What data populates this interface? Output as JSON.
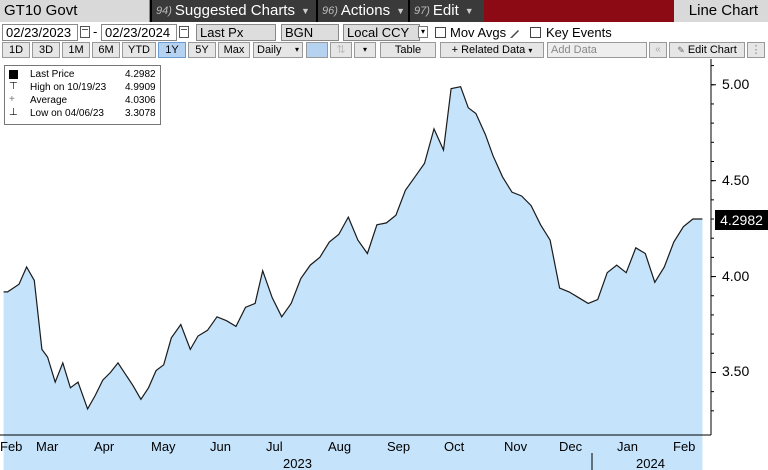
{
  "titlebar": {
    "security": "GT10 Govt",
    "menus": [
      {
        "num": "94)",
        "label": "Suggested Charts"
      },
      {
        "num": "96)",
        "label": "Actions"
      },
      {
        "num": "97)",
        "label": "Edit"
      }
    ],
    "window_title": "Line Chart"
  },
  "controls": {
    "start_date": "02/23/2023",
    "end_date": "02/23/2024",
    "field": "Last Px",
    "source": "BGN",
    "currency": "Local CCY",
    "mov_avgs_label": "Mov Avgs",
    "key_events_label": "Key Events"
  },
  "toolbar": {
    "periods": [
      "1D",
      "3D",
      "1M",
      "6M",
      "YTD",
      "1Y",
      "5Y",
      "Max"
    ],
    "selected_period": "1Y",
    "frequency": "Daily",
    "table_label": "Table",
    "related_data_label": "+ Related Data",
    "add_data_placeholder": "Add Data",
    "edit_chart_label": "Edit Chart"
  },
  "legend": {
    "items": [
      {
        "label": "Last Price",
        "value": "4.2982"
      },
      {
        "label": "High on 10/19/23",
        "value": "4.9909"
      },
      {
        "label": "Average",
        "value": "4.0306"
      },
      {
        "label": "Low on 04/06/23",
        "value": "3.3078"
      }
    ]
  },
  "last_value_badge": "4.2982",
  "colors": {
    "line": "#1a1a1a",
    "fill": "#c5e3fa",
    "titlebar_red": "#8b0a14",
    "selected_button": "#b5d3f1"
  },
  "chart_data": {
    "type": "area",
    "title": "",
    "xlabel": "",
    "ylabel": "",
    "ylim": [
      3.2,
      5.15
    ],
    "yticks": [
      3.5,
      4.0,
      4.5,
      5.0
    ],
    "ytick_labels": [
      "3.50",
      "4.00",
      "4.50",
      "5.00"
    ],
    "x_month_labels": [
      "Feb",
      "Mar",
      "Apr",
      "May",
      "Jun",
      "Jul",
      "Aug",
      "Sep",
      "Oct",
      "Nov",
      "Dec",
      "Jan",
      "Feb"
    ],
    "x_year_labels": [
      "2023",
      "2024"
    ],
    "grid": false,
    "legend_position": "top-left",
    "series": [
      {
        "name": "Last Price",
        "x": [
          "2023-02-23",
          "2023-03-01",
          "2023-03-05",
          "2023-03-09",
          "2023-03-13",
          "2023-03-16",
          "2023-03-20",
          "2023-03-24",
          "2023-03-28",
          "2023-04-01",
          "2023-04-06",
          "2023-04-10",
          "2023-04-14",
          "2023-04-18",
          "2023-04-22",
          "2023-04-26",
          "2023-04-30",
          "2023-05-04",
          "2023-05-08",
          "2023-05-12",
          "2023-05-16",
          "2023-05-20",
          "2023-05-25",
          "2023-05-30",
          "2023-06-03",
          "2023-06-08",
          "2023-06-13",
          "2023-06-18",
          "2023-06-23",
          "2023-06-28",
          "2023-07-03",
          "2023-07-07",
          "2023-07-12",
          "2023-07-17",
          "2023-07-22",
          "2023-07-27",
          "2023-08-01",
          "2023-08-06",
          "2023-08-11",
          "2023-08-16",
          "2023-08-21",
          "2023-08-26",
          "2023-08-31",
          "2023-09-05",
          "2023-09-10",
          "2023-09-15",
          "2023-09-20",
          "2023-09-25",
          "2023-09-30",
          "2023-10-05",
          "2023-10-10",
          "2023-10-14",
          "2023-10-19",
          "2023-10-23",
          "2023-10-27",
          "2023-11-01",
          "2023-11-05",
          "2023-11-10",
          "2023-11-15",
          "2023-11-20",
          "2023-11-25",
          "2023-11-30",
          "2023-12-05",
          "2023-12-10",
          "2023-12-15",
          "2023-12-20",
          "2023-12-25",
          "2023-12-30",
          "2024-01-04",
          "2024-01-09",
          "2024-01-14",
          "2024-01-19",
          "2024-01-24",
          "2024-01-29",
          "2024-02-03",
          "2024-02-08",
          "2024-02-13",
          "2024-02-18",
          "2024-02-23"
        ],
        "values": [
          3.92,
          3.96,
          4.05,
          3.98,
          3.62,
          3.58,
          3.45,
          3.55,
          3.42,
          3.45,
          3.31,
          3.38,
          3.46,
          3.5,
          3.55,
          3.49,
          3.43,
          3.36,
          3.42,
          3.51,
          3.54,
          3.68,
          3.75,
          3.62,
          3.69,
          3.72,
          3.79,
          3.77,
          3.74,
          3.84,
          3.86,
          4.03,
          3.89,
          3.79,
          3.86,
          3.99,
          4.06,
          4.1,
          4.18,
          4.22,
          4.31,
          4.19,
          4.12,
          4.27,
          4.28,
          4.32,
          4.45,
          4.52,
          4.59,
          4.77,
          4.66,
          4.98,
          4.99,
          4.88,
          4.85,
          4.74,
          4.63,
          4.52,
          4.44,
          4.42,
          4.37,
          4.27,
          4.19,
          3.94,
          3.92,
          3.89,
          3.86,
          3.88,
          4.02,
          4.06,
          4.02,
          4.15,
          4.12,
          3.97,
          4.05,
          4.18,
          4.26,
          4.3,
          4.3
        ]
      }
    ]
  }
}
